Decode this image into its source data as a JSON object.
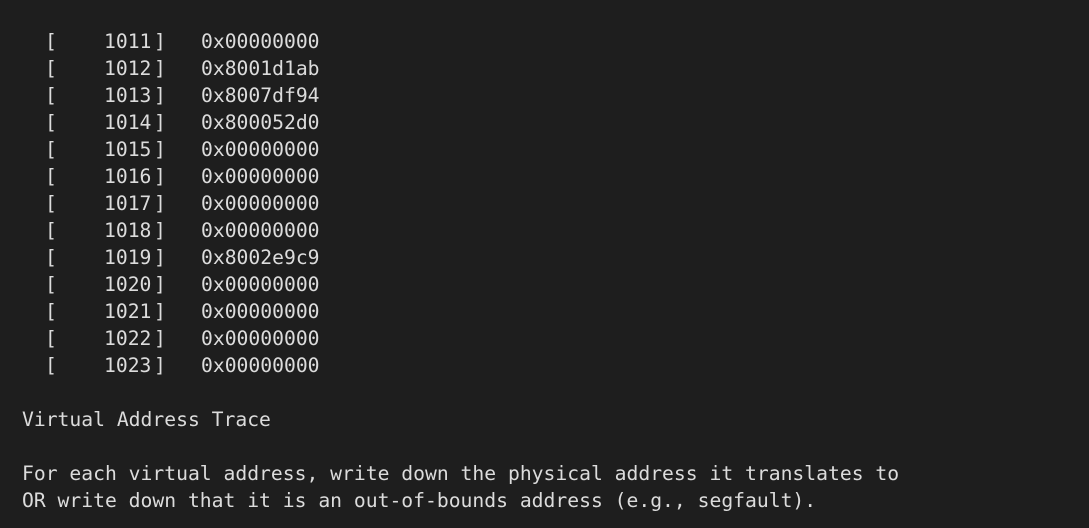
{
  "page_table": {
    "open_bracket": "[",
    "close_bracket": "]",
    "rows": [
      {
        "index": "1011",
        "value": "0x00000000"
      },
      {
        "index": "1012",
        "value": "0x8001d1ab"
      },
      {
        "index": "1013",
        "value": "0x8007df94"
      },
      {
        "index": "1014",
        "value": "0x800052d0"
      },
      {
        "index": "1015",
        "value": "0x00000000"
      },
      {
        "index": "1016",
        "value": "0x00000000"
      },
      {
        "index": "1017",
        "value": "0x00000000"
      },
      {
        "index": "1018",
        "value": "0x00000000"
      },
      {
        "index": "1019",
        "value": "0x8002e9c9"
      },
      {
        "index": "1020",
        "value": "0x00000000"
      },
      {
        "index": "1021",
        "value": "0x00000000"
      },
      {
        "index": "1022",
        "value": "0x00000000"
      },
      {
        "index": "1023",
        "value": "0x00000000"
      }
    ]
  },
  "section_heading": "Virtual Address Trace",
  "instructions": {
    "line1": "For each virtual address, write down the physical address it translates to",
    "line2": "OR write down that it is an out-of-bounds address (e.g., segfault)."
  }
}
